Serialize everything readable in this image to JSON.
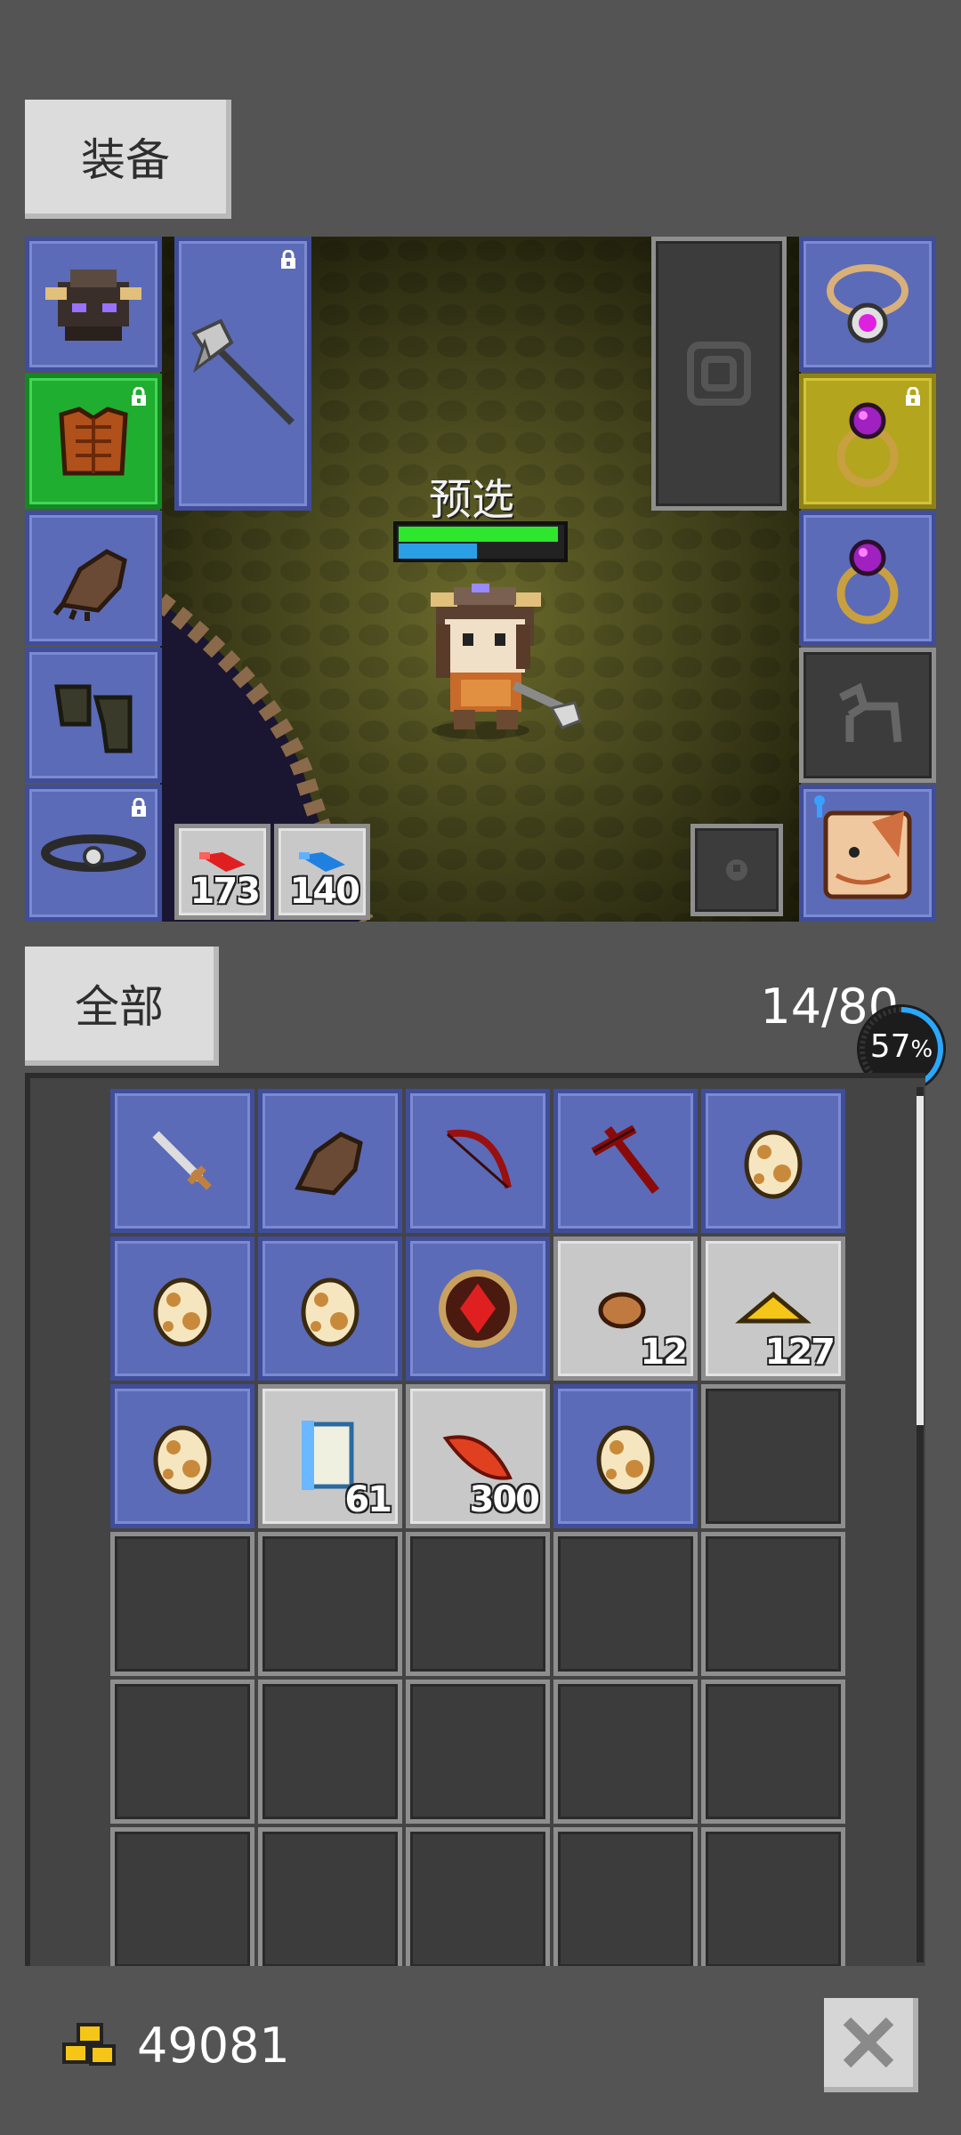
{
  "equipment_tab": {
    "label": "装备"
  },
  "character": {
    "label": "预选",
    "hp_fraction": 0.95,
    "mp_fraction": 0.47
  },
  "potions": [
    {
      "name": "red-potion-icon",
      "count": "173"
    },
    {
      "name": "blue-potion-icon",
      "count": "140"
    }
  ],
  "equip_slots_left": [
    {
      "name": "helmet-slot",
      "icon": "helmet-icon",
      "locked": false,
      "rarity": "blue"
    },
    {
      "name": "armor-slot",
      "icon": "armor-icon",
      "locked": true,
      "rarity": "green"
    },
    {
      "name": "gloves-slot",
      "icon": "gloves-icon",
      "locked": false,
      "rarity": "blue"
    },
    {
      "name": "boots-slot",
      "icon": "boots-icon",
      "locked": false,
      "rarity": "blue"
    },
    {
      "name": "belt-slot",
      "icon": "belt-icon",
      "locked": true,
      "rarity": "blue"
    }
  ],
  "equip_slots_right": [
    {
      "name": "necklace-slot",
      "icon": "necklace-icon",
      "locked": false,
      "rarity": "blue"
    },
    {
      "name": "ring-slot-1",
      "icon": "ring-icon",
      "locked": true,
      "rarity": "yellow"
    },
    {
      "name": "ring-slot-2",
      "icon": "ring-icon",
      "locked": false,
      "rarity": "blue"
    },
    {
      "name": "mount-slot",
      "icon": "horse-icon",
      "locked": false,
      "rarity": "empty"
    },
    {
      "name": "pet-slot",
      "icon": "pet-icon",
      "locked": false,
      "rarity": "blue"
    }
  ],
  "weapon_slot": {
    "icon": "axe-icon",
    "locked": true
  },
  "inventory": {
    "filter_tab": "全部",
    "capacity": "14/80",
    "progress": "57",
    "progress_unit": "%",
    "items": [
      {
        "icon": "sword-icon",
        "rarity": "blue",
        "count": ""
      },
      {
        "icon": "gloves-icon",
        "rarity": "blue",
        "count": ""
      },
      {
        "icon": "bow-icon",
        "rarity": "blue",
        "count": ""
      },
      {
        "icon": "crossbow-icon",
        "rarity": "blue",
        "count": ""
      },
      {
        "icon": "egg-icon",
        "rarity": "blue",
        "count": ""
      },
      {
        "icon": "egg-icon",
        "rarity": "blue",
        "count": ""
      },
      {
        "icon": "egg-icon",
        "rarity": "blue",
        "count": ""
      },
      {
        "icon": "amulet-icon",
        "rarity": "blue",
        "count": ""
      },
      {
        "icon": "ore-icon",
        "rarity": "grey",
        "count": "12"
      },
      {
        "icon": "gold-icon",
        "rarity": "grey",
        "count": "127"
      },
      {
        "icon": "egg-icon",
        "rarity": "blue",
        "count": ""
      },
      {
        "icon": "scroll-icon",
        "rarity": "grey",
        "count": "61"
      },
      {
        "icon": "feather-icon",
        "rarity": "grey",
        "count": "300"
      },
      {
        "icon": "egg-icon",
        "rarity": "blue",
        "count": ""
      }
    ]
  },
  "footer": {
    "gold_amount": "49081",
    "gold_icon": "gold-coins-icon",
    "close_icon": "close-icon"
  },
  "colors": {
    "background": "#545454",
    "slot_blue": "#5b6bb8",
    "slot_green": "#1fae2f",
    "slot_yellow": "#b3a51e",
    "hp_bar": "#2ee62e",
    "mp_bar": "#2b9fe6"
  }
}
